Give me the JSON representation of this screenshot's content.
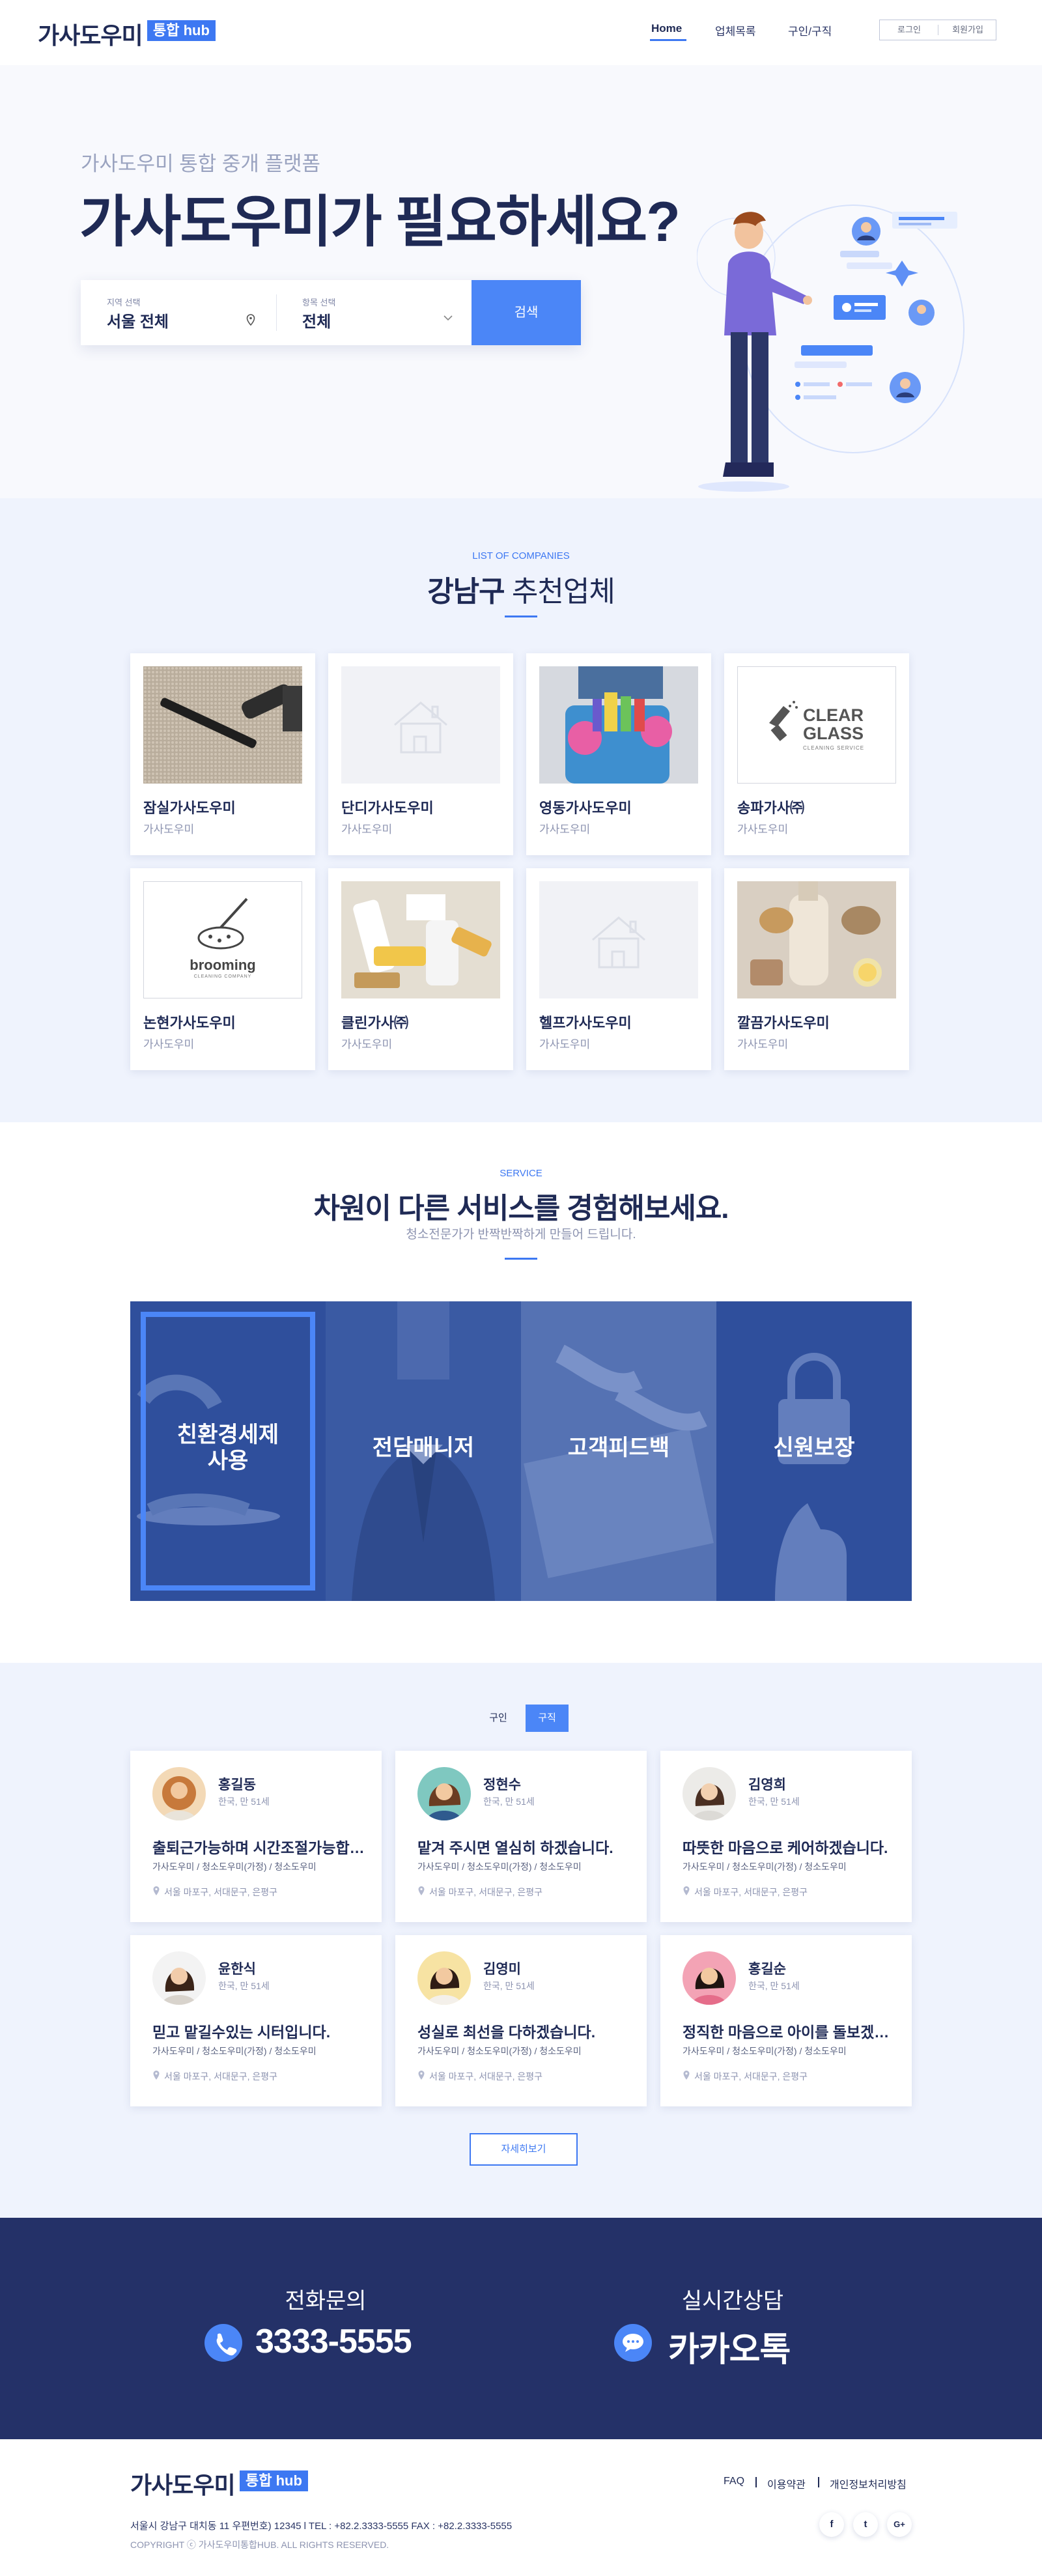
{
  "header": {
    "logo": "가사도우미",
    "badge": "통합 hub",
    "nav": [
      "Home",
      "업체목록",
      "구인/구직"
    ],
    "login": "로그인",
    "signup": "회원가입"
  },
  "hero": {
    "subtitle": "가사도우미 통합 중개 플랫폼",
    "title": "가사도우미가 필요하세요?",
    "search": {
      "region_label": "지역 선택",
      "region_value": "서울 전체",
      "category_label": "항목 선택",
      "category_value": "전체",
      "button": "검색"
    }
  },
  "companies": {
    "eyebrow": "LIST OF COMPANIES",
    "title_strong": "강남구",
    "title_rest": "추천업체",
    "items": [
      {
        "name": "잠실가사도우미",
        "sub": "가사도우미",
        "image": "carpet-vacuum-photo"
      },
      {
        "name": "단디가사도우미",
        "sub": "가사도우미",
        "image": "house-placeholder-icon"
      },
      {
        "name": "영동가사도우미",
        "sub": "가사도우미",
        "image": "cleaning-supplies-photo"
      },
      {
        "name": "송파가사㈜",
        "sub": "가사도우미",
        "image": "clear-glass-logo",
        "logo_text": [
          "CLEAR",
          "GLASS",
          "CLEANING SERVICE"
        ]
      },
      {
        "name": "논현가사도우미",
        "sub": "가사도우미",
        "image": "brooming-logo",
        "logo_text": [
          "brooming",
          "CLEANING COMPANY"
        ]
      },
      {
        "name": "클린가사㈜",
        "sub": "가사도우미",
        "image": "spray-brushes-photo"
      },
      {
        "name": "헬프가사도우미",
        "sub": "가사도우미",
        "image": "house-placeholder-icon"
      },
      {
        "name": "깔끔가사도우미",
        "sub": "가사도우미",
        "image": "eco-products-photo"
      }
    ]
  },
  "service": {
    "eyebrow": "SERVICE",
    "title": "차원이 다른 서비스를 경험해보세요.",
    "subtitle": "청소전문가가 반짝반짝하게 만들어 드립니다.",
    "panels": [
      {
        "label": "친환경세제\n사용",
        "selected": true
      },
      {
        "label": "전담매니저",
        "selected": false
      },
      {
        "label": "고객피드백",
        "selected": false
      },
      {
        "label": "신원보장",
        "selected": false
      }
    ]
  },
  "talent": {
    "tabs": [
      {
        "label": "구인",
        "active": false
      },
      {
        "label": "구직",
        "active": true
      }
    ],
    "people": [
      {
        "name": "홍길동",
        "meta": "한국, 만 51세",
        "headline": "출퇴근가능하며 시간조절가능합니다",
        "tags": "가사도우미 / 청소도우미(가정) / 청소도우미",
        "location": "서울 마포구, 서대문구, 은평구",
        "avatar": "avatar-man-1"
      },
      {
        "name": "정현수",
        "meta": "한국, 만 51세",
        "headline": "맡겨 주시면 열심히 하겠습니다.",
        "tags": "가사도우미 / 청소도우미(가정) / 청소도우미",
        "location": "서울 마포구, 서대문구, 은평구",
        "avatar": "avatar-woman-1"
      },
      {
        "name": "김영희",
        "meta": "한국, 만 51세",
        "headline": "따뜻한 마음으로 케어하겠습니다.",
        "tags": "가사도우미 / 청소도우미(가정) / 청소도우미",
        "location": "서울 마포구, 서대문구, 은평구",
        "avatar": "avatar-woman-2"
      },
      {
        "name": "윤한식",
        "meta": "한국, 만 51세",
        "headline": "믿고 맡길수있는 시터입니다.",
        "tags": "가사도우미 / 청소도우미(가정) / 청소도우미",
        "location": "서울 마포구, 서대문구, 은평구",
        "avatar": "avatar-woman-3"
      },
      {
        "name": "김영미",
        "meta": "한국, 만 51세",
        "headline": "성실로 최선을 다하겠습니다.",
        "tags": "가사도우미 / 청소도우미(가정) / 청소도우미",
        "location": "서울 마포구, 서대문구, 은평구",
        "avatar": "avatar-woman-4"
      },
      {
        "name": "홍길순",
        "meta": "한국, 만 51세",
        "headline": "정직한 마음으로 아이를 돌보겠습니다",
        "tags": "가사도우미 / 청소도우미(가정) / 청소도우미",
        "location": "서울 마포구, 서대문구, 은평구",
        "avatar": "avatar-woman-5"
      }
    ],
    "more_button": "자세히보기"
  },
  "contact": {
    "phone_label": "전화문의",
    "phone_value": "3333-5555",
    "chat_label": "실시간상담",
    "chat_value": "카카오톡"
  },
  "footer": {
    "logo": "가사도우미",
    "badge": "통합 hub",
    "links": [
      "FAQ",
      "이용약관",
      "개인정보처리방침"
    ],
    "address": "서울시 강남구 대치동 11 우편번호) 12345   l   TEL : +82.2.3333-5555  FAX : +82.2.3333-5555",
    "copyright": "COPYRIGHT ⓒ 가사도우미통합HUB. ALL RIGHTS RESERVED.",
    "social": [
      "f",
      "t",
      "G+"
    ]
  },
  "colors": {
    "accent": "#3d78f2",
    "navy": "#1f2a55",
    "panel_overlay": "#2f4f9c"
  }
}
